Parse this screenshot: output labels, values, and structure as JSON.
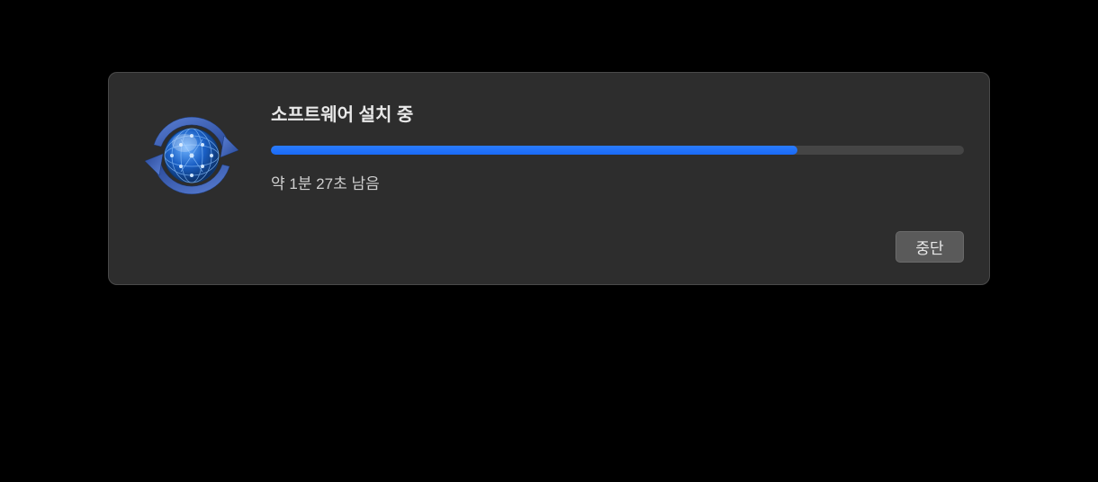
{
  "dialog": {
    "title": "소프트웨어 설치 중",
    "status": "약 1분 27초 남음",
    "stop_label": "중단",
    "progress_percent": 76,
    "icon": "software-update-icon"
  },
  "colors": {
    "accent": "#1f6ff5",
    "dialog_bg": "#2d2d2d",
    "track": "#454545"
  }
}
